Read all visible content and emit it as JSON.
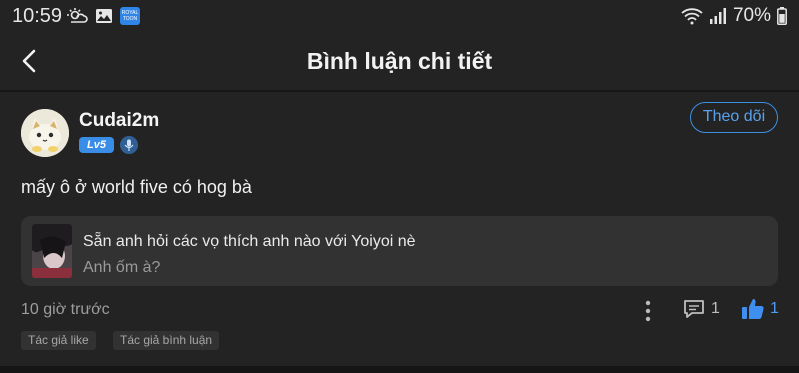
{
  "status_bar": {
    "time": "10:59",
    "battery": "70%",
    "app_badge_text": "ROYAL TOON"
  },
  "header": {
    "title": "Bình luận chi tiết"
  },
  "user": {
    "name": "Cudai2m",
    "level": "Lv5",
    "follow_label": "Theo dõi"
  },
  "comment": {
    "text": "mấy ô ở world five có hog bà",
    "time_ago": "10 giờ trước",
    "reply_count": "1",
    "like_count": "1"
  },
  "quoted_work": {
    "title": "Sẵn anh hỏi các vọ thích anh nào với Yoiyoi nè",
    "subtitle": "Anh ốm à?"
  },
  "tags": [
    "Tác giả like",
    "Tác giả bình luận"
  ],
  "colors": {
    "background": "#232323",
    "card": "#323232",
    "accent": "#3d8fe3"
  }
}
